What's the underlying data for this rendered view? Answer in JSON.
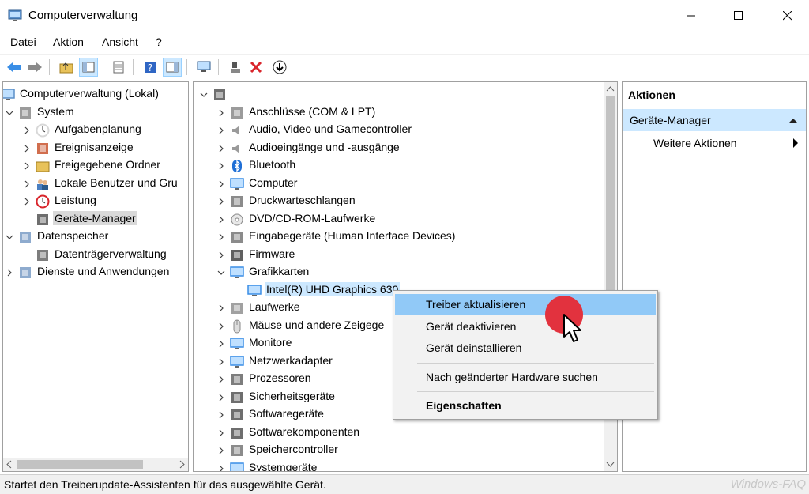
{
  "window": {
    "title": "Computerverwaltung"
  },
  "menubar": [
    "Datei",
    "Aktion",
    "Ansicht",
    "?"
  ],
  "left_tree": [
    {
      "label": "Computerverwaltung (Lokal)",
      "icon": "computer-management-icon",
      "level": 0,
      "expander": ""
    },
    {
      "label": "System",
      "icon": "tools-icon",
      "level": 1,
      "expander": "expanded"
    },
    {
      "label": "Aufgabenplanung",
      "icon": "clock-icon",
      "level": 2,
      "expander": "collapsed"
    },
    {
      "label": "Ereignisanzeige",
      "icon": "event-viewer-icon",
      "level": 2,
      "expander": "collapsed"
    },
    {
      "label": "Freigegebene Ordner",
      "icon": "shared-folder-icon",
      "level": 2,
      "expander": "collapsed"
    },
    {
      "label": "Lokale Benutzer und Gru",
      "icon": "users-icon",
      "level": 2,
      "expander": "collapsed"
    },
    {
      "label": "Leistung",
      "icon": "performance-icon",
      "level": 2,
      "expander": "collapsed"
    },
    {
      "label": "Geräte-Manager",
      "icon": "device-manager-icon",
      "level": 2,
      "expander": "",
      "selected": true
    },
    {
      "label": "Datenspeicher",
      "icon": "storage-icon",
      "level": 1,
      "expander": "expanded"
    },
    {
      "label": "Datenträgerverwaltung",
      "icon": "disk-management-icon",
      "level": 2,
      "expander": ""
    },
    {
      "label": "Dienste und Anwendungen",
      "icon": "services-icon",
      "level": 1,
      "expander": "collapsed"
    }
  ],
  "device_tree": [
    {
      "label": "",
      "icon": "computer-root-icon",
      "level": 0,
      "expander": "expanded"
    },
    {
      "label": "Anschlüsse (COM & LPT)",
      "icon": "port-icon",
      "level": 1,
      "expander": "collapsed"
    },
    {
      "label": "Audio, Video und Gamecontroller",
      "icon": "speaker-icon",
      "level": 1,
      "expander": "collapsed"
    },
    {
      "label": "Audioeingänge und -ausgänge",
      "icon": "audio-io-icon",
      "level": 1,
      "expander": "collapsed"
    },
    {
      "label": "Bluetooth",
      "icon": "bluetooth-icon",
      "level": 1,
      "expander": "collapsed"
    },
    {
      "label": "Computer",
      "icon": "monitor-icon",
      "level": 1,
      "expander": "collapsed"
    },
    {
      "label": "Druckwarteschlangen",
      "icon": "printer-icon",
      "level": 1,
      "expander": "collapsed"
    },
    {
      "label": "DVD/CD-ROM-Laufwerke",
      "icon": "disc-icon",
      "level": 1,
      "expander": "collapsed"
    },
    {
      "label": "Eingabegeräte (Human Interface Devices)",
      "icon": "hid-icon",
      "level": 1,
      "expander": "collapsed"
    },
    {
      "label": "Firmware",
      "icon": "firmware-icon",
      "level": 1,
      "expander": "collapsed"
    },
    {
      "label": "Grafikkarten",
      "icon": "display-adapter-icon",
      "level": 1,
      "expander": "expanded"
    },
    {
      "label": "Intel(R) UHD Graphics 630",
      "icon": "display-adapter-icon",
      "level": 2,
      "expander": "",
      "selected": true
    },
    {
      "label": "Laufwerke",
      "icon": "drive-icon",
      "level": 1,
      "expander": "collapsed"
    },
    {
      "label": "Mäuse und andere Zeigege",
      "icon": "mouse-icon",
      "level": 1,
      "expander": "collapsed"
    },
    {
      "label": "Monitore",
      "icon": "monitor-icon",
      "level": 1,
      "expander": "collapsed"
    },
    {
      "label": "Netzwerkadapter",
      "icon": "network-icon",
      "level": 1,
      "expander": "collapsed"
    },
    {
      "label": "Prozessoren",
      "icon": "cpu-icon",
      "level": 1,
      "expander": "collapsed"
    },
    {
      "label": "Sicherheitsgeräte",
      "icon": "security-icon",
      "level": 1,
      "expander": "collapsed"
    },
    {
      "label": "Softwaregeräte",
      "icon": "software-device-icon",
      "level": 1,
      "expander": "collapsed"
    },
    {
      "label": "Softwarekomponenten",
      "icon": "software-component-icon",
      "level": 1,
      "expander": "collapsed"
    },
    {
      "label": "Speichercontroller",
      "icon": "storage-controller-icon",
      "level": 1,
      "expander": "collapsed"
    },
    {
      "label": "Systemgeräte",
      "icon": "system-device-icon",
      "level": 1,
      "expander": "collapsed"
    }
  ],
  "actions": {
    "header": "Aktionen",
    "section": "Geräte-Manager",
    "more": "Weitere Aktionen"
  },
  "context_menu": [
    {
      "label": "Treiber aktualisieren",
      "highlighted": true
    },
    {
      "label": "Gerät deaktivieren"
    },
    {
      "label": "Gerät deinstallieren"
    },
    {
      "separator": true
    },
    {
      "label": "Nach geänderter Hardware suchen"
    },
    {
      "separator": true
    },
    {
      "label": "Eigenschaften",
      "bold": true
    }
  ],
  "status": "Startet den Treiberupdate-Assistenten für das ausgewählte Gerät.",
  "watermark": "Windows-FAQ",
  "colors": {
    "selection": "#cce8ff",
    "menu_highlight": "#91c9f7",
    "cursor_highlight": "#e2323e"
  }
}
